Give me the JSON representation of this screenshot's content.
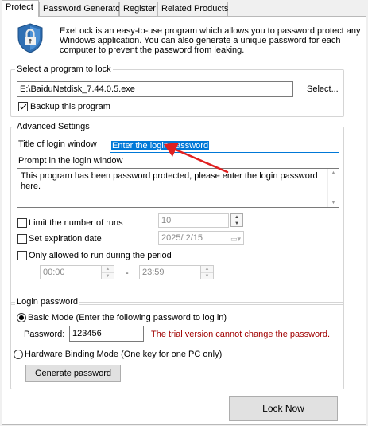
{
  "tabs": [
    {
      "label": "Protect",
      "active": true
    },
    {
      "label": "Password Generator",
      "active": false
    },
    {
      "label": "Register",
      "active": false
    },
    {
      "label": "Related Products",
      "active": false
    }
  ],
  "intro": {
    "icon": "lock-shield-icon",
    "text_line1": "ExeLock is an easy-to-use program which allows you to password protect any",
    "text_line2": "Windows application. You can also generate a unique password for each",
    "text_line3": "computer to prevent the password from leaking."
  },
  "select_program": {
    "title": "Select a program to lock",
    "path_value": "E:\\BaiduNetdisk_7.44.0.5.exe",
    "select_button": "Select...",
    "backup_label": "Backup this program",
    "backup_checked": true
  },
  "advanced": {
    "title": "Advanced Settings",
    "login_title_label": "Title of login window",
    "login_title_value": "Enter the login password",
    "prompt_label": "Prompt in the login window",
    "prompt_value": "This program has been password protected, please enter the login password here.",
    "limit_runs_label": "Limit the number of runs",
    "limit_runs_checked": false,
    "limit_runs_value": "10",
    "expiration_label": "Set expiration date",
    "expiration_checked": false,
    "expiration_value": "2025/  2/15",
    "period_label": "Only allowed to run during the period",
    "period_checked": false,
    "period_start": "00:00",
    "period_dash": "-",
    "period_end": "23:59"
  },
  "login_password": {
    "title": "Login password",
    "basic_mode_label": "Basic Mode (Enter the following password to log in)",
    "basic_mode_selected": true,
    "password_label": "Password:",
    "password_value": "123456",
    "trial_warning": "The trial version cannot change the password.",
    "warning_color": "#a00000",
    "hardware_mode_label": "Hardware Binding Mode (One key for one PC only)",
    "hardware_mode_selected": false,
    "generate_button": "Generate password"
  },
  "lock_now_button": "Lock Now",
  "annotation_arrow_color": "#e02020"
}
